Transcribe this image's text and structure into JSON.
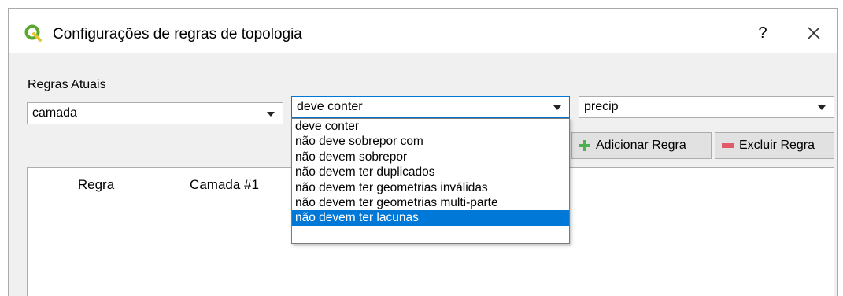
{
  "window": {
    "title": "Configurações de regras de topologia",
    "help_label": "?",
    "close_icon": "close-icon",
    "app_icon": "qgis-logo-icon"
  },
  "rules": {
    "section_label": "Regras Atuais",
    "layer_combo": {
      "value": "camada"
    },
    "rule_combo": {
      "value": "deve conter",
      "options": [
        "deve conter",
        "não deve sobrepor com",
        "não devem sobrepor",
        "não devem ter duplicados",
        "não devem ter geometrias inválidas",
        "não devem ter geometrias multi-parte",
        "não devem ter lacunas"
      ],
      "highlighted_index": 6
    },
    "target_combo": {
      "value": "precip"
    },
    "add_button": {
      "label": "Adicionar Regra",
      "icon": "plus-icon"
    },
    "delete_button": {
      "label": "Excluir Regra",
      "icon": "minus-icon"
    }
  },
  "table": {
    "columns": [
      "Regra",
      "Camada #1"
    ]
  },
  "colors": {
    "highlight": "#0078d7",
    "add_icon": "#4caf50",
    "delete_icon": "#e05a6a",
    "logo_green": "#5aa832"
  }
}
